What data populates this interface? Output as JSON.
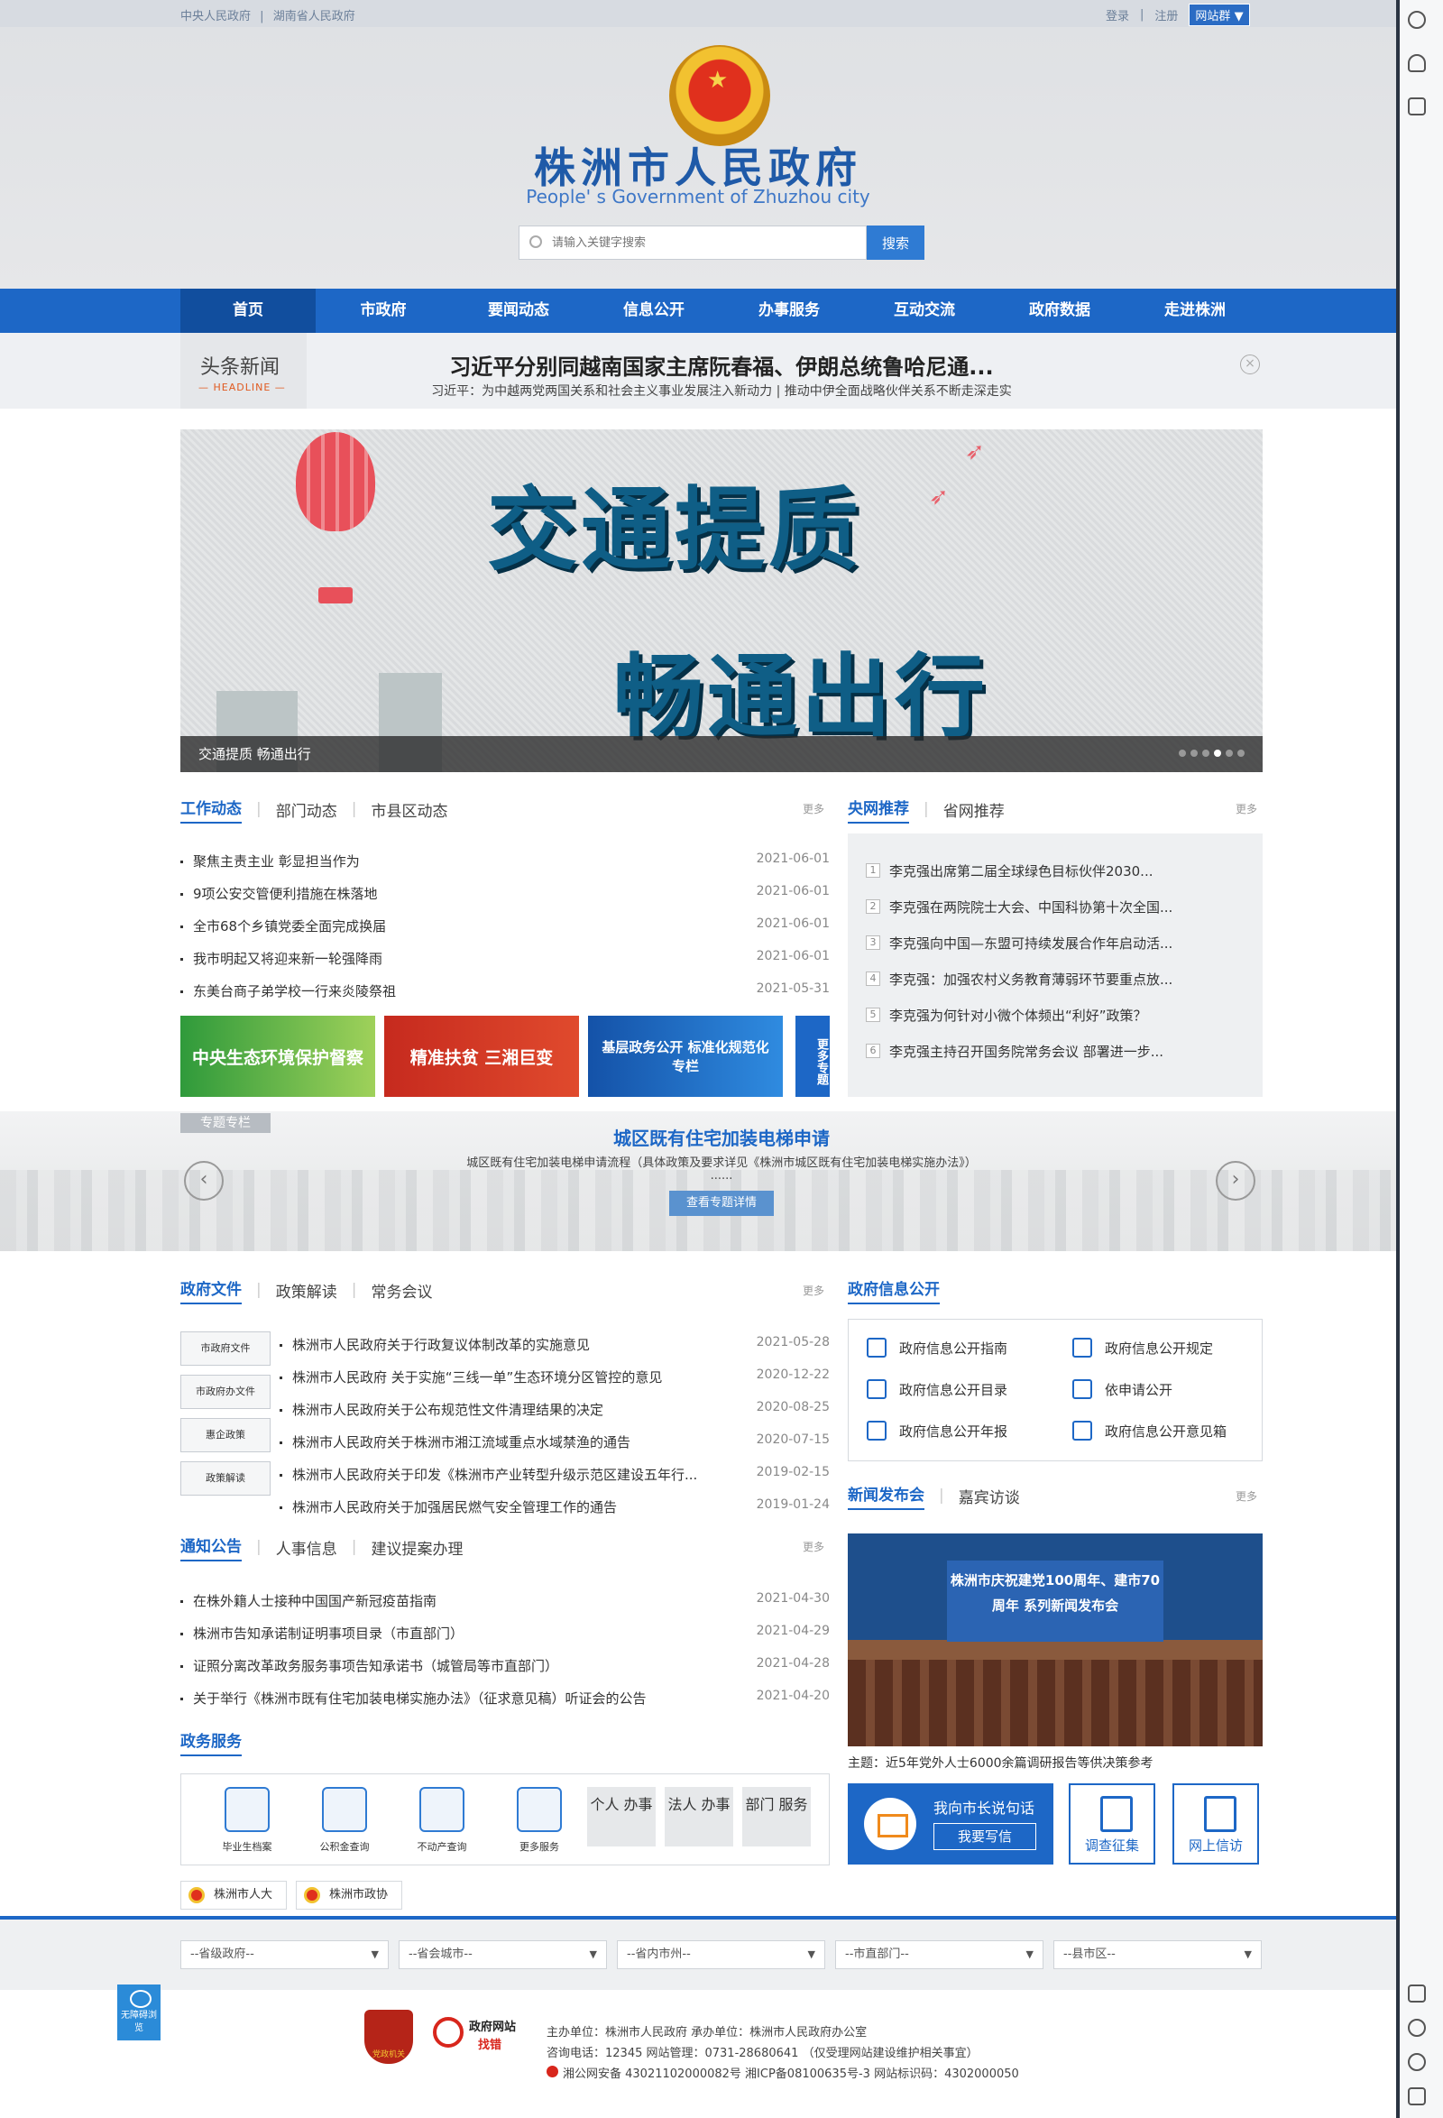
{
  "topbar": {
    "links": [
      "中央人民政府",
      "|",
      "湖南省人民政府"
    ],
    "login": "登录",
    "sep": "|",
    "register": "注册",
    "site_group": "网站群"
  },
  "header": {
    "title": "株洲市人民政府",
    "subtitle": "People' s Government of Zhuzhou city",
    "search_placeholder": "请输入关键字搜索",
    "search_button": "搜索"
  },
  "nav": [
    "首页",
    "市政府",
    "要闻动态",
    "信息公开",
    "办事服务",
    "互动交流",
    "政府数据",
    "走进株洲"
  ],
  "headline": {
    "label": "头条新闻",
    "label_en": "— HEADLINE —",
    "title": "习近平分别同越南国家主席阮春福、伊朗总统鲁哈尼通...",
    "subtitle": "习近平：为中越两党两国关系和社会主义事业发展注入新动力 | 推动中伊全面战略伙伴关系不断走深走实"
  },
  "banner": {
    "text1": "交通提质",
    "text2": "畅通出行",
    "caption": "交通提质 畅通出行"
  },
  "work": {
    "tabs": [
      "工作动态",
      "部门动态",
      "市县区动态"
    ],
    "more": "更多",
    "items": [
      {
        "title": "聚焦主责主业 彰显担当作为",
        "date": "2021-06-01"
      },
      {
        "title": "9项公安交管便利措施在株落地",
        "date": "2021-06-01"
      },
      {
        "title": "全市68个乡镇党委全面完成换届",
        "date": "2021-06-01"
      },
      {
        "title": "我市明起又将迎来新一轮强降雨",
        "date": "2021-06-01"
      },
      {
        "title": "东美台商子弟学校一行来炎陵祭祖",
        "date": "2021-05-31"
      }
    ],
    "tiles": [
      "中央生态环境保护督察",
      "精准扶贫 三湘巨变",
      "基层政务公开 标准化规范化专栏"
    ],
    "more_tile": "更多专题"
  },
  "rec": {
    "tabs": [
      "央网推荐",
      "省网推荐"
    ],
    "more": "更多",
    "items": [
      "李克强出席第二届全球绿色目标伙伴2030...",
      "李克强在两院院士大会、中国科协第十次全国...",
      "李克强向中国—东盟可持续发展合作年启动活...",
      "李克强：加强农村义务教育薄弱环节要重点放...",
      "李克强为何针对小微个体频出“利好”政策？",
      "李克强主持召开国务院常务会议 部署进一步..."
    ]
  },
  "topic": {
    "tag": "专题专栏",
    "title": "城区既有住宅加装电梯申请",
    "subtitle": "城区既有住宅加装电梯申请流程（具体政策及要求详见《株洲市城区既有住宅加装电梯实施办法》）",
    "ellipsis": "......",
    "button": "查看专题详情"
  },
  "docs": {
    "tabs": [
      "政府文件",
      "政策解读",
      "常务会议"
    ],
    "more": "更多",
    "categories": [
      "市政府文件",
      "市政府办文件",
      "惠企政策",
      "政策解读"
    ],
    "items": [
      {
        "title": "株洲市人民政府关于行政复议体制改革的实施意见",
        "date": "2021-05-28"
      },
      {
        "title": "株洲市人民政府 关于实施“三线一单”生态环境分区管控的意见",
        "date": "2020-12-22"
      },
      {
        "title": "株洲市人民政府关于公布规范性文件清理结果的决定",
        "date": "2020-08-25"
      },
      {
        "title": "株洲市人民政府关于株洲市湘江流域重点水域禁渔的通告",
        "date": "2020-07-15"
      },
      {
        "title": "株洲市人民政府关于印发《株洲市产业转型升级示范区建设五年行...",
        "date": "2019-02-15"
      },
      {
        "title": "株洲市人民政府关于加强居民燃气安全管理工作的通告",
        "date": "2019-01-24"
      }
    ]
  },
  "info": {
    "title": "政府信息公开",
    "items": [
      "政府信息公开指南",
      "政府信息公开规定",
      "政府信息公开目录",
      "依申请公开",
      "政府信息公开年报",
      "政府信息公开意见箱"
    ]
  },
  "notice": {
    "tabs": [
      "通知公告",
      "人事信息",
      "建议提案办理"
    ],
    "more": "更多",
    "items": [
      {
        "title": "在株外籍人士接种中国国产新冠疫苗指南",
        "date": "2021-04-30"
      },
      {
        "title": "株洲市告知承诺制证明事项目录（市直部门）",
        "date": "2021-04-29"
      },
      {
        "title": "证照分离改革政务服务事项告知承诺书（城管局等市直部门）",
        "date": "2021-04-28"
      },
      {
        "title": "关于举行《株洲市既有住宅加装电梯实施办法》（征求意见稿）听证会的公告",
        "date": "2021-04-20"
      }
    ]
  },
  "press": {
    "tabs": [
      "新闻发布会",
      "嘉宾访谈"
    ],
    "more": "更多",
    "banner_text": "株洲市庆祝建党100周年、建市70周年 系列新闻发布会",
    "caption": "主题：近5年党外人士6000余篇调研报告等供决策参考"
  },
  "services": {
    "title": "政务服务",
    "items": [
      "毕业生档案",
      "公积金查询",
      "不动产查询",
      "更多服务"
    ],
    "buttons": [
      "个人 办事",
      "法人 办事",
      "部门 服务"
    ]
  },
  "interact": {
    "mayor": "我向市长说句话",
    "write": "我要写信",
    "survey": "调查征集",
    "petition": "网上信访"
  },
  "links": [
    "株洲市人大",
    "株洲市政协"
  ],
  "selects": [
    "--省级政府--",
    "--省会城市--",
    "--省内市州--",
    "--市直部门--",
    "--县市区--"
  ],
  "footer": {
    "badge1": "党政机关",
    "badge2_line1": "政府网站",
    "badge2_line2": "找错",
    "line1": "主办单位：株洲市人民政府 承办单位：株洲市人民政府办公室",
    "line2": "咨询电话：12345 网站管理：0731-28680641 （仅受理网站建设维护相关事宜）",
    "line3": "湘公网安备 43021102000082号 湘ICP备08100635号-3 网站标识码：4302000050",
    "accessibility": "无障碍浏览"
  }
}
